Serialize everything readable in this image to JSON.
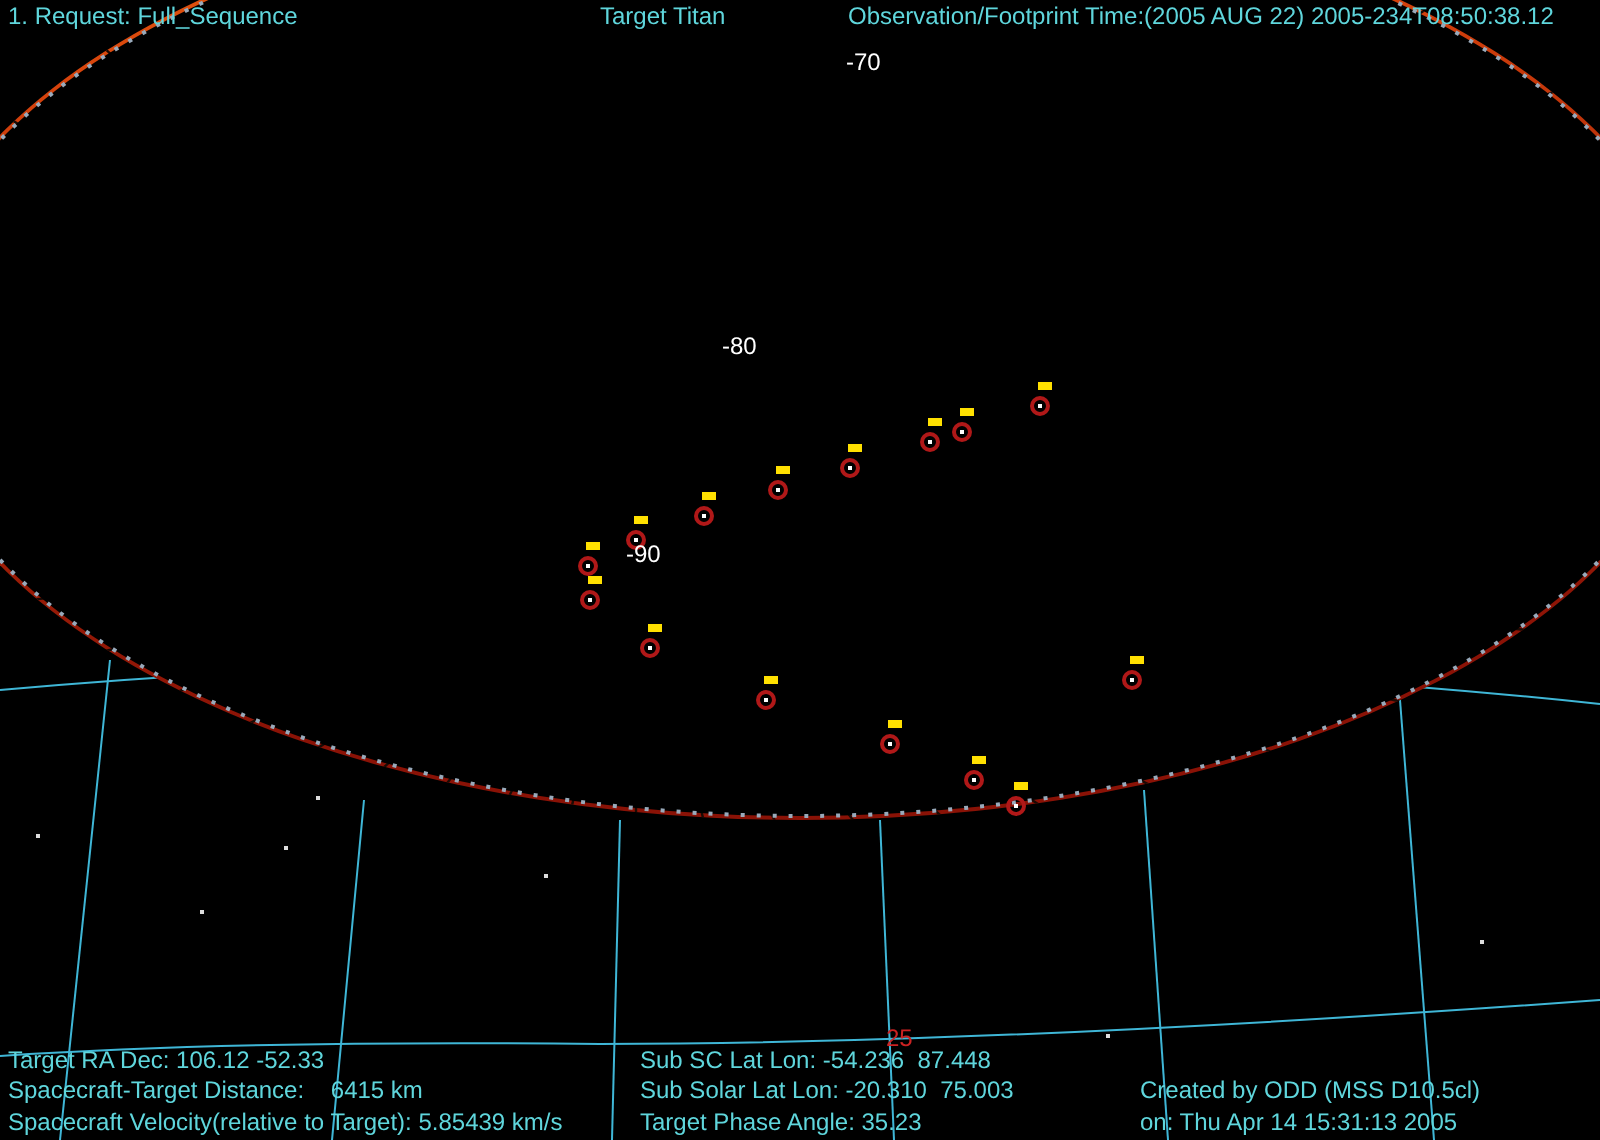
{
  "header": {
    "request": "1. Request: Full_Sequence",
    "target": "Target Titan",
    "time": "Observation/Footprint Time:(2005 AUG 22) 2005-234T08:50:38.12"
  },
  "map": {
    "latitude_labels": [
      "-70",
      "-80",
      "-90"
    ],
    "sky_label": "25"
  },
  "footer": {
    "left": [
      "Target RA Dec: 106.12 -52.33",
      "Spacecraft-Target Distance:    6415 km",
      "Spacecraft Velocity(relative to Target): 5.85439 km/s"
    ],
    "middle": [
      "Sub SC Lat Lon: -54.236  87.448",
      "Sub Solar Lat Lon: -20.310  75.003",
      "Target Phase Angle: 35.23"
    ],
    "right": [
      "Created by ODD (MSS D10.5cl)",
      "on: Thu Apr 14 15:31:13 2005"
    ]
  }
}
